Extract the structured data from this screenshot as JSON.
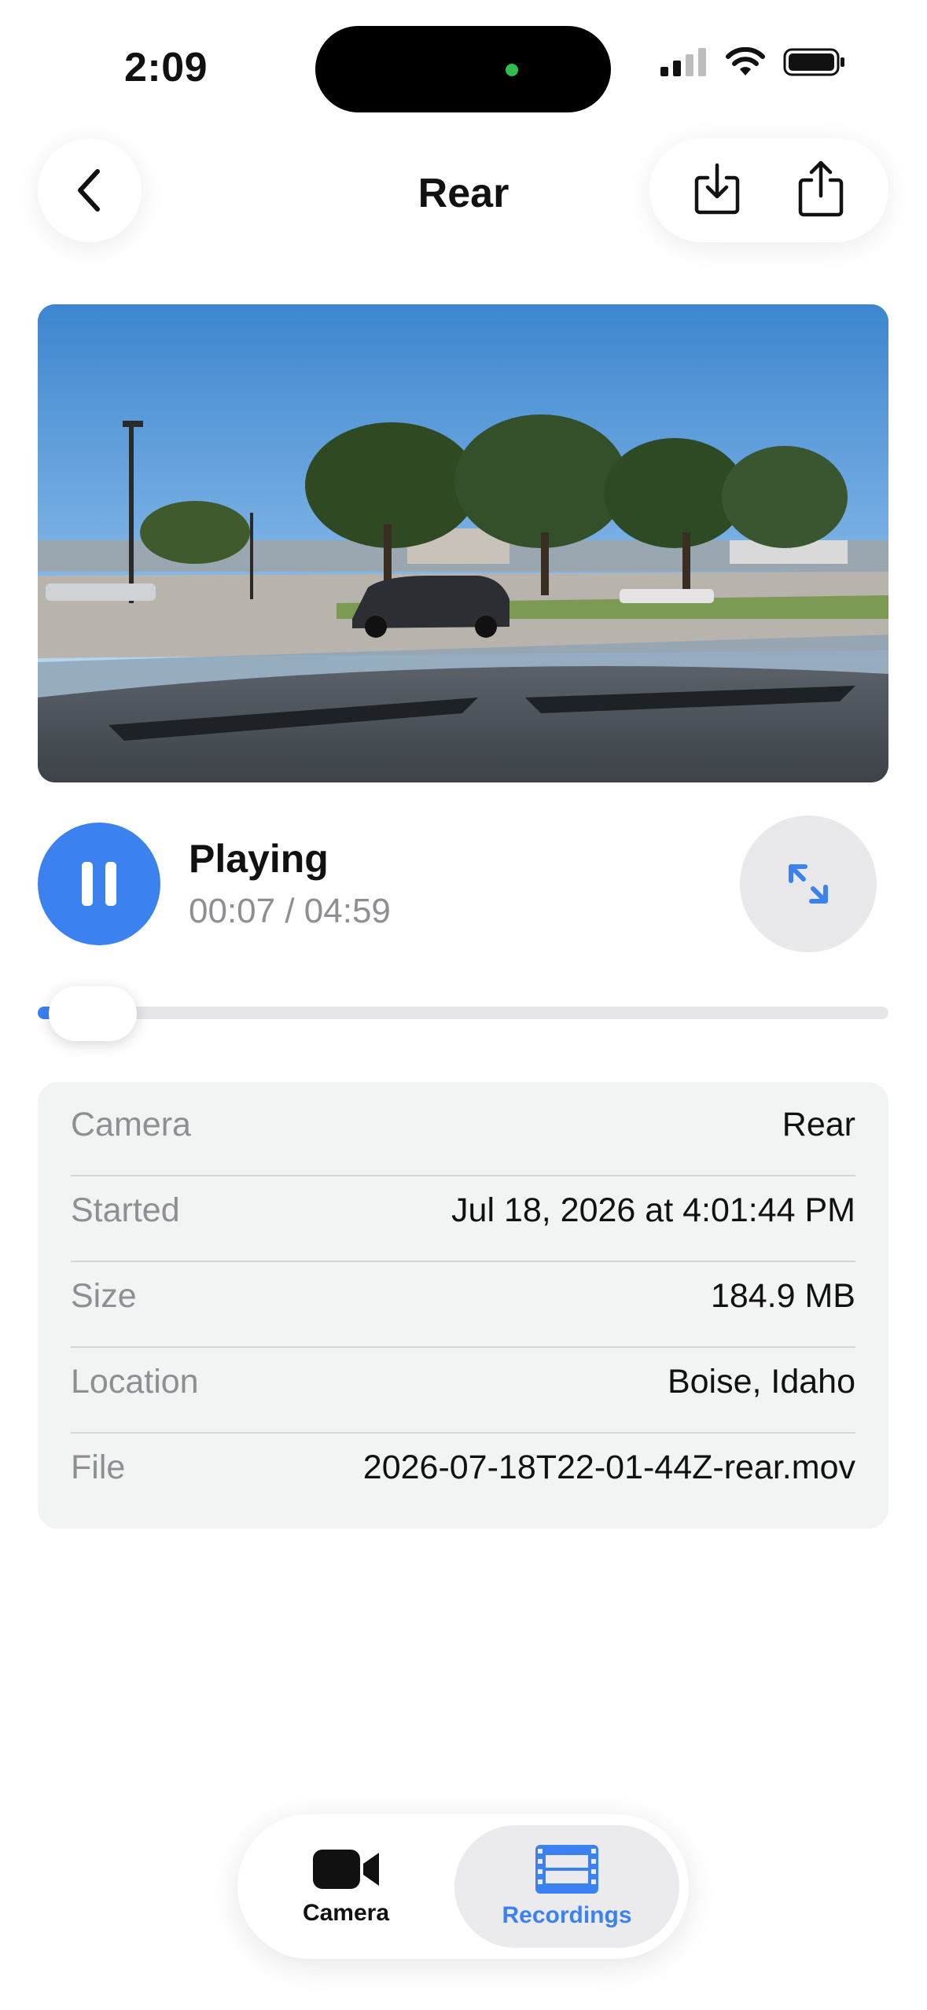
{
  "status_bar": {
    "time": "2:09",
    "icons": [
      "cellular-signal-icon",
      "wifi-icon",
      "battery-icon"
    ]
  },
  "header": {
    "title": "Rear",
    "back_icon": "chevron-left-icon",
    "download_icon": "download-icon",
    "share_icon": "share-icon"
  },
  "video": {
    "description_icon": "video-frame"
  },
  "playback": {
    "state": "Playing",
    "time": "00:07 / 04:59",
    "progress": 0.023,
    "pause_icon": "pause-icon",
    "expand_icon": "expand-icon"
  },
  "details": {
    "rows": [
      {
        "label": "Camera",
        "value": "Rear"
      },
      {
        "label": "Started",
        "value": "Jul 18, 2026 at 4:01:44 PM"
      },
      {
        "label": "Size",
        "value": "184.9 MB"
      },
      {
        "label": "Location",
        "value": "Boise, Idaho"
      },
      {
        "label": "File",
        "value": "2026-07-18T22-01-44Z-rear.mov"
      }
    ]
  },
  "tabbar": {
    "tabs": [
      {
        "label": "Camera",
        "icon": "video-camera-icon",
        "active": false
      },
      {
        "label": "Recordings",
        "icon": "film-strip-icon",
        "active": true
      }
    ]
  },
  "colors": {
    "accent": "#3b82f0",
    "secondary_text": "#8e8e93",
    "card_bg": "#f2f3f3"
  }
}
